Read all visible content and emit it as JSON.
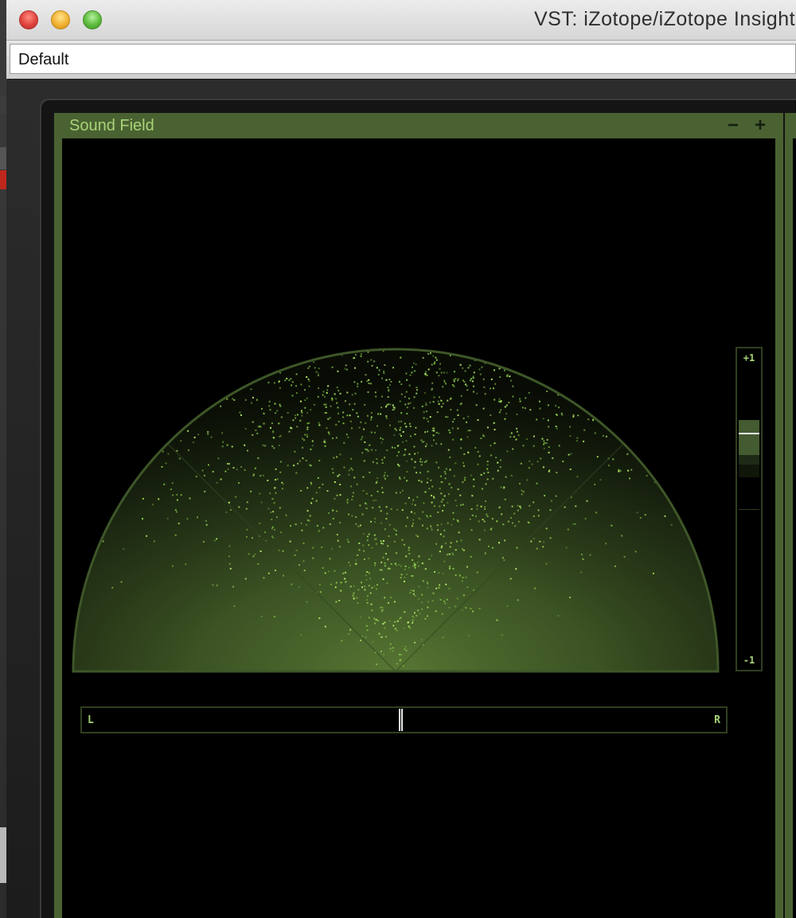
{
  "window": {
    "title": "VST: iZotope/iZotope Insight",
    "buttons": [
      "close",
      "minimize",
      "zoom"
    ]
  },
  "preset": {
    "value": "Default"
  },
  "panel": {
    "title": "Sound Field",
    "collapse_label": "−",
    "expand_label": "+",
    "accent_color": "#a7d377",
    "frame_color": "#4a6232"
  },
  "balance": {
    "left_label": "L",
    "right_label": "R",
    "position": 0.495
  },
  "correlation": {
    "top_label": "+1",
    "bottom_label": "-1",
    "value": 0.54,
    "range_high": 0.63,
    "range_low": 0.38
  },
  "icons": {
    "collapse": "minus-icon",
    "expand": "plus-icon"
  }
}
